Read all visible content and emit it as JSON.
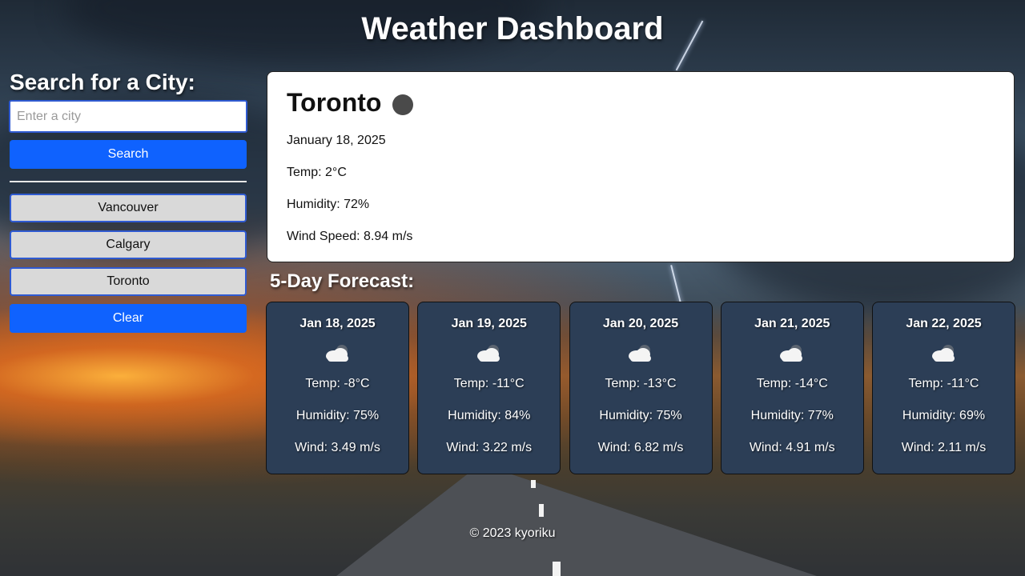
{
  "header": {
    "title": "Weather Dashboard"
  },
  "sidebar": {
    "heading": "Search for a City:",
    "search_placeholder": "Enter a city",
    "search_value": "",
    "search_button": "Search",
    "history": [
      {
        "label": "Vancouver"
      },
      {
        "label": "Calgary"
      },
      {
        "label": "Toronto"
      }
    ],
    "clear_button": "Clear"
  },
  "current": {
    "city": "Toronto",
    "icon": "weather-dot-icon",
    "date": "January 18, 2025",
    "temp": "Temp: 2°C",
    "humidity": "Humidity: 72%",
    "wind": "Wind Speed: 8.94 m/s"
  },
  "forecast": {
    "heading": "5-Day Forecast:",
    "days": [
      {
        "date": "Jan 18, 2025",
        "icon": "cloud-icon",
        "temp": "Temp: -8°C",
        "humidity": "Humidity: 75%",
        "wind": "Wind: 3.49 m/s"
      },
      {
        "date": "Jan 19, 2025",
        "icon": "cloud-icon",
        "temp": "Temp: -11°C",
        "humidity": "Humidity: 84%",
        "wind": "Wind: 3.22 m/s"
      },
      {
        "date": "Jan 20, 2025",
        "icon": "cloud-icon",
        "temp": "Temp: -13°C",
        "humidity": "Humidity: 75%",
        "wind": "Wind: 6.82 m/s"
      },
      {
        "date": "Jan 21, 2025",
        "icon": "cloud-icon",
        "temp": "Temp: -14°C",
        "humidity": "Humidity: 77%",
        "wind": "Wind: 4.91 m/s"
      },
      {
        "date": "Jan 22, 2025",
        "icon": "cloud-icon",
        "temp": "Temp: -11°C",
        "humidity": "Humidity: 69%",
        "wind": "Wind: 2.11 m/s"
      }
    ]
  },
  "footer": {
    "text": "© 2023 kyoriku"
  },
  "colors": {
    "primary_button": "#0f62fe",
    "history_button": "#d9d9d9",
    "forecast_card": "#2c3e56",
    "current_card": "#ffffff"
  }
}
